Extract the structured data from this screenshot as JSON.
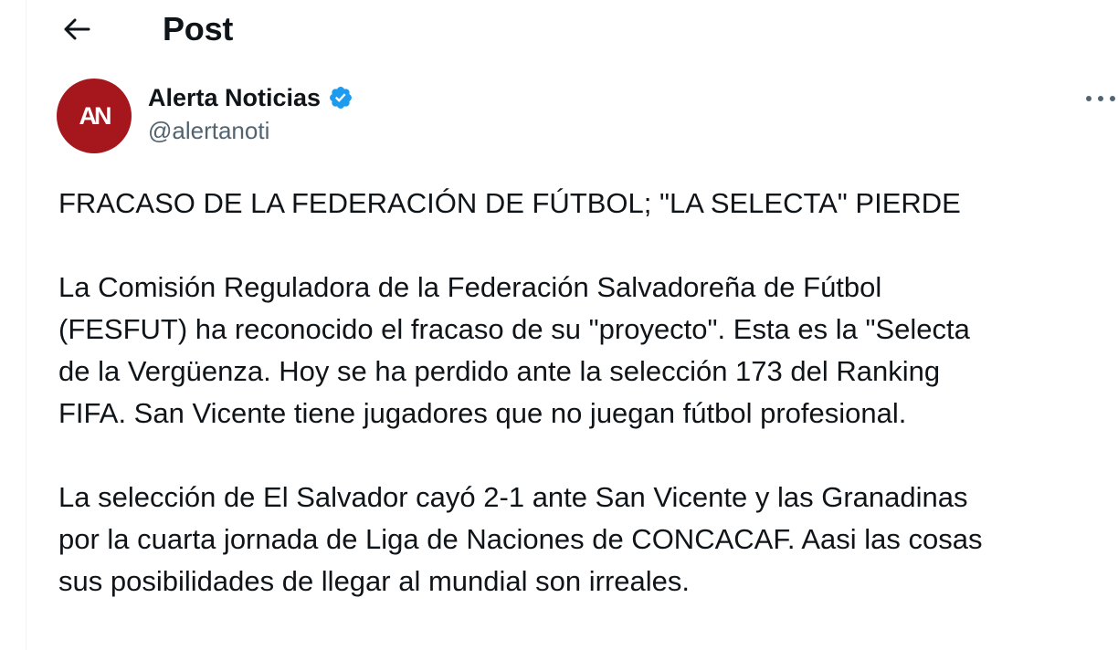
{
  "header": {
    "title": "Post"
  },
  "author": {
    "avatar_text": "AN",
    "display_name": "Alerta Noticias",
    "handle": "@alertanoti",
    "verified": true
  },
  "colors": {
    "avatar_bg": "#a5161d",
    "verified": "#1d9bf0",
    "secondary_text": "#536471"
  },
  "tweet": {
    "paragraphs": [
      [
        "FRACASO DE LA FEDERACIÓN DE FÚTBOL; \"LA SELECTA\" PIERDE"
      ],
      [
        "La Comisión Reguladora de la Federación Salvadoreña de Fútbol",
        "(FESFUT) ha reconocido el fracaso de su \"proyecto\". Esta es la \"Selecta",
        "de la Vergüenza. Hoy se ha perdido ante la selección 173 del Ranking",
        "FIFA. San Vicente tiene jugadores que no juegan fútbol profesional."
      ],
      [
        "La selección de El Salvador cayó 2-1 ante San Vicente y las Granadinas",
        "por la cuarta jornada de Liga de Naciones de CONCACAF. Aasi las cosas",
        "sus posibilidades de llegar al mundial son irreales."
      ]
    ]
  },
  "icons": {
    "back": "arrow-left-icon",
    "verified": "verified-badge-icon",
    "more": "more-horizontal-icon"
  }
}
